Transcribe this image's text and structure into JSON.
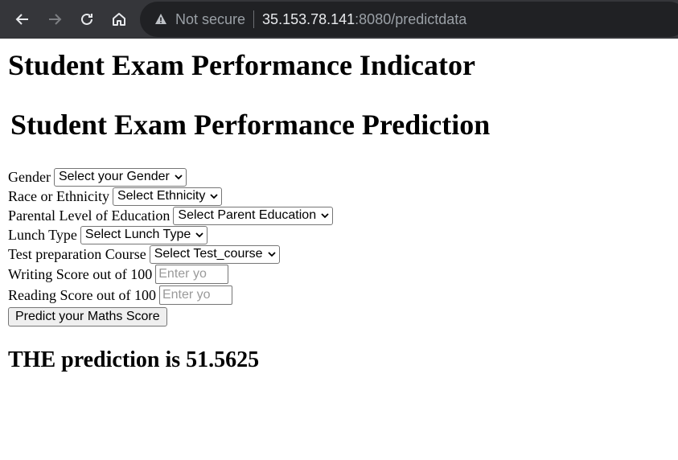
{
  "browser": {
    "security_label": "Not secure",
    "host": "35.153.78.141",
    "path": ":8080/predictdata"
  },
  "page": {
    "title": "Student Exam Performance Indicator",
    "subtitle": "Student Exam Performance Prediction",
    "form": {
      "gender_label": "Gender",
      "gender_value": "Select your Gender",
      "ethnicity_label": "Race or Ethnicity",
      "ethnicity_value": "Select Ethnicity",
      "parent_edu_label": "Parental Level of Education",
      "parent_edu_value": "Select Parent Education",
      "lunch_label": "Lunch Type",
      "lunch_value": "Select Lunch Type",
      "test_prep_label": "Test preparation Course",
      "test_prep_value": "Select Test_course",
      "writing_label": "Writing Score out of 100",
      "writing_placeholder": "Enter yo",
      "reading_label": "Reading Score out of 100",
      "reading_placeholder": "Enter yo",
      "submit_label": "Predict your Maths Score"
    },
    "result": "THE prediction is 51.5625"
  },
  "icons": [
    "back-arrow-icon",
    "forward-arrow-icon",
    "reload-icon",
    "home-icon",
    "warning-icon",
    "chevron-down-icon"
  ]
}
